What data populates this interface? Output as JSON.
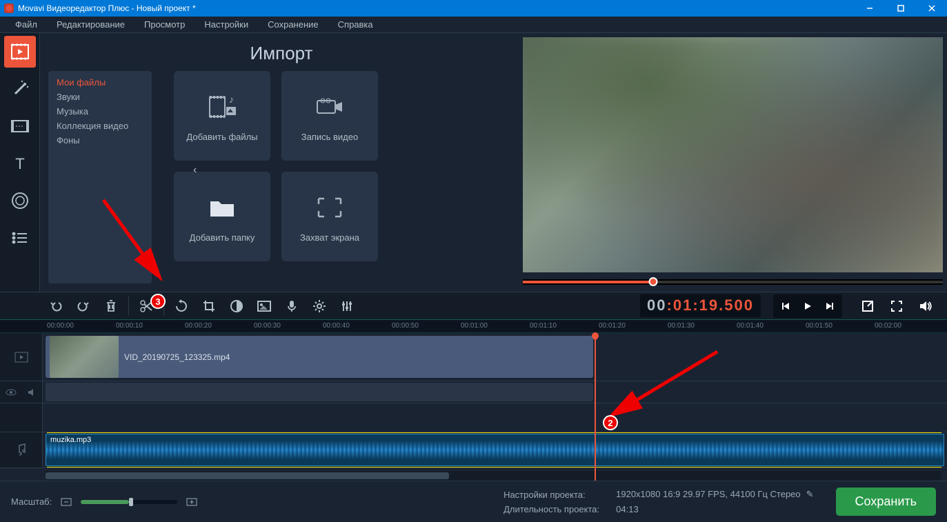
{
  "titlebar": {
    "text": "Movavi Видеоредактор Плюс - Новый проект *"
  },
  "menu": {
    "file": "Файл",
    "edit": "Редактирование",
    "view": "Просмотр",
    "settings": "Настройки",
    "save": "Сохранение",
    "help": "Справка"
  },
  "import": {
    "title": "Импорт",
    "cats": {
      "my_files": "Мои файлы",
      "sounds": "Звуки",
      "music": "Музыка",
      "video_collection": "Коллекция видео",
      "backgrounds": "Фоны"
    },
    "tiles": {
      "add_files": "Добавить файлы",
      "record_video": "Запись видео",
      "add_folder": "Добавить папку",
      "screen_capture": "Захват экрана"
    }
  },
  "timecode": {
    "hh": "00",
    "mm": "01",
    "ss": "19",
    "ms": "500"
  },
  "ruler": [
    "00:00:00",
    "00:00:10",
    "00:00:20",
    "00:00:30",
    "00:00:40",
    "00:00:50",
    "00:01:00",
    "00:01:10",
    "00:01:20",
    "00:01:30",
    "00:01:40",
    "00:01:50",
    "00:02:00"
  ],
  "clips": {
    "video_name": "VID_20190725_123325.mp4",
    "audio_name": "muzika.mp3"
  },
  "footer": {
    "zoom_label": "Масштаб:",
    "proj_settings_label": "Настройки проекта:",
    "proj_settings_value": "1920x1080 16:9 29.97 FPS, 44100 Гц Стерео",
    "duration_label": "Длительность проекта:",
    "duration_value": "04:13",
    "save_btn": "Сохранить"
  },
  "annotations": {
    "badge2": "2",
    "badge3": "3"
  }
}
